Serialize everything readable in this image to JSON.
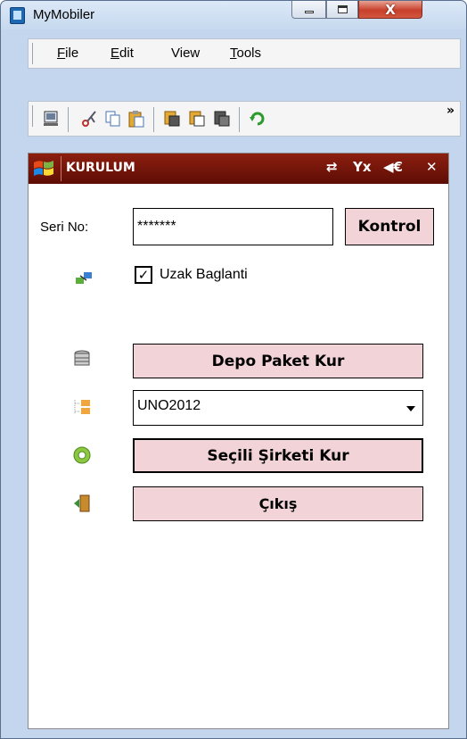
{
  "window": {
    "title": "MyMobiler",
    "close_glyph": "X"
  },
  "menu": {
    "items": [
      {
        "label_prefix": "",
        "underline": "F",
        "label_rest": "ile"
      },
      {
        "label_prefix": "",
        "underline": "E",
        "label_rest": "dit"
      },
      {
        "label_prefix": "View",
        "underline": "",
        "label_rest": ""
      },
      {
        "label_prefix": "",
        "underline": "T",
        "label_rest": "ools"
      }
    ]
  },
  "toolbar": {
    "overflow": "»",
    "icons": [
      "device-icon",
      "cut-icon",
      "copy-icon",
      "paste-icon",
      "paste-special-icon",
      "paste-format-icon",
      "paste-dark-icon",
      "refresh-icon"
    ]
  },
  "device": {
    "title": "KURULUM",
    "status_sync": "⇄",
    "status_filter": "Yx",
    "status_sound": "◀€",
    "close": "✕"
  },
  "form": {
    "serial_label": "Seri No:",
    "serial_value": "*******",
    "kontrol_label": "Kontrol",
    "uzak_checked": "✓",
    "uzak_label": "Uzak Baglanti",
    "depo_label": "Depo Paket Kur",
    "company_selected": "UNO2012",
    "secili_label": "Seçili Şirketi Kur",
    "cikis_label": "Çıkış"
  },
  "colors": {
    "button_pink": "#f2d3d7",
    "device_bar": "#7a1a0c",
    "window_frame": "#c3d6ee"
  }
}
